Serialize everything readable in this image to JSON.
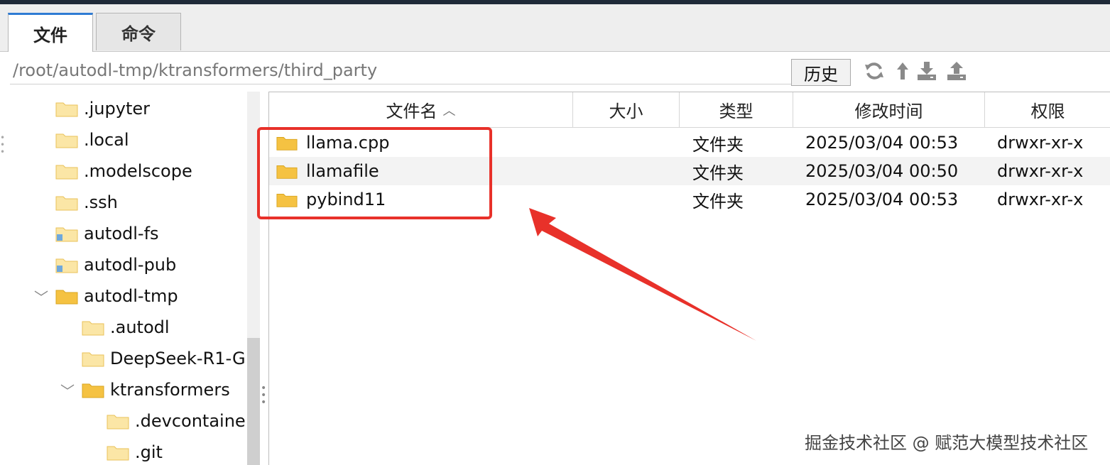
{
  "tabs": [
    {
      "label": "文件",
      "active": true
    },
    {
      "label": "命令",
      "active": false
    }
  ],
  "path_bar": {
    "path": "/root/autodl-tmp/ktransformers/third_party",
    "history_label": "历史"
  },
  "toolbar_icons": [
    "refresh-icon",
    "up-icon",
    "download-icon",
    "upload-icon"
  ],
  "tree": {
    "items": [
      {
        "label": ".jupyter",
        "icon": "folder-icon"
      },
      {
        "label": ".local",
        "icon": "folder-icon"
      },
      {
        "label": ".modelscope",
        "icon": "folder-icon"
      },
      {
        "label": ".ssh",
        "icon": "folder-icon"
      },
      {
        "label": "autodl-fs",
        "icon": "folder-link-icon"
      },
      {
        "label": "autodl-pub",
        "icon": "folder-link-icon"
      },
      {
        "label": "autodl-tmp",
        "icon": "folder-icon",
        "expanded": true
      },
      {
        "label": ".autodl",
        "icon": "folder-icon"
      },
      {
        "label": "DeepSeek-R1-G",
        "icon": "folder-icon"
      },
      {
        "label": "ktransformers",
        "icon": "folder-icon",
        "expanded": true
      },
      {
        "label": ".devcontaine",
        "icon": "folder-icon"
      },
      {
        "label": ".git",
        "icon": "folder-icon"
      }
    ]
  },
  "file_table": {
    "columns": [
      "文件名",
      "大小",
      "类型",
      "修改时间",
      "权限"
    ],
    "rows": [
      {
        "name": "llama.cpp",
        "size": "",
        "type": "文件夹",
        "mtime": "2025/03/04 00:53",
        "perm": "drwxr-xr-x"
      },
      {
        "name": "llamafile",
        "size": "",
        "type": "文件夹",
        "mtime": "2025/03/04 00:50",
        "perm": "drwxr-xr-x"
      },
      {
        "name": "pybind11",
        "size": "",
        "type": "文件夹",
        "mtime": "2025/03/04 00:53",
        "perm": "drwxr-xr-x"
      }
    ]
  },
  "annotation": {
    "color": "#e8312a"
  },
  "watermark": "掘金技术社区 @ 赋范大模型技术社区",
  "colors": {
    "folder": "#f5c242",
    "accent": "#2f7bd4"
  }
}
